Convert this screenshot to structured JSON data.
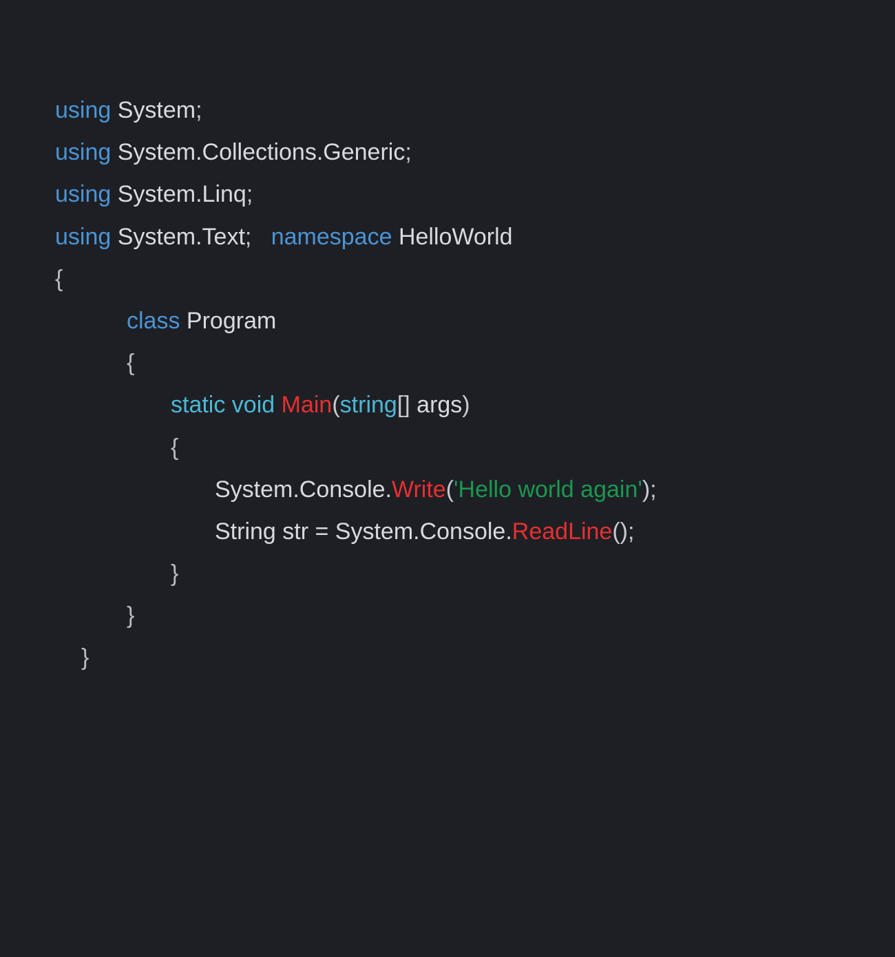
{
  "code": {
    "keywords": {
      "using": "using",
      "namespace": "namespace",
      "class": "class",
      "static_void": "static void",
      "string": "string"
    },
    "identifiers": {
      "system": "System",
      "collections_generic": "System.Collections.Generic",
      "linq": "System.Linq",
      "text": "System.Text",
      "helloworld": "HelloWorld",
      "program": "Program",
      "main": "Main",
      "args": "args",
      "system_console": "System.Console.",
      "write": "Write",
      "readline": "ReadLine",
      "string_str": "String str = System.Console."
    },
    "strings": {
      "hello_world": "'Hello world again'"
    },
    "punct": {
      "semi": ";",
      "open_brace": "{",
      "close_brace": "}",
      "open_paren": "(",
      "close_paren": ")",
      "brackets_close": "[] ",
      "empty_parens_semi": "();",
      "close_paren_semi": ");",
      "space": " ",
      "space2": "  ",
      "space3": "   "
    }
  }
}
